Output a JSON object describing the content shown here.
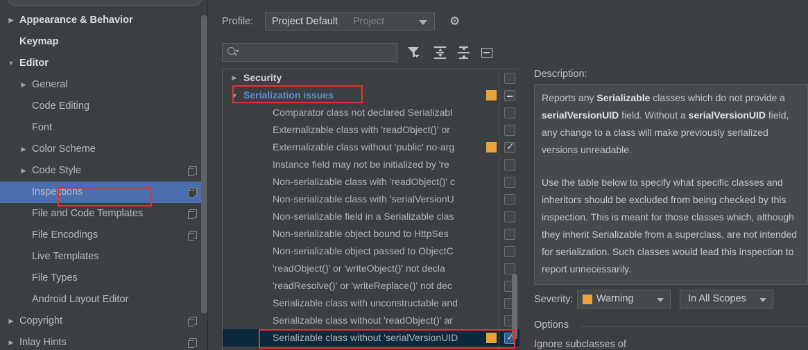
{
  "sidebar": {
    "search_placeholder": "",
    "items": [
      {
        "label": "Appearance & Behavior",
        "arrow": "collapsed",
        "indent": 28,
        "bold": true,
        "copy": false,
        "selected": false
      },
      {
        "label": "Keymap",
        "arrow": "none",
        "indent": 28,
        "bold": true,
        "copy": false,
        "selected": false
      },
      {
        "label": "Editor",
        "arrow": "expanded",
        "indent": 28,
        "bold": true,
        "copy": false,
        "selected": false
      },
      {
        "label": "General",
        "arrow": "collapsed",
        "indent": 46,
        "bold": false,
        "copy": false,
        "selected": false
      },
      {
        "label": "Code Editing",
        "arrow": "none",
        "indent": 46,
        "bold": false,
        "copy": false,
        "selected": false
      },
      {
        "label": "Font",
        "arrow": "none",
        "indent": 46,
        "bold": false,
        "copy": false,
        "selected": false
      },
      {
        "label": "Color Scheme",
        "arrow": "collapsed",
        "indent": 46,
        "bold": false,
        "copy": false,
        "selected": false
      },
      {
        "label": "Code Style",
        "arrow": "collapsed",
        "indent": 46,
        "bold": false,
        "copy": true,
        "selected": false
      },
      {
        "label": "Inspections",
        "arrow": "none",
        "indent": 46,
        "bold": false,
        "copy": true,
        "selected": true
      },
      {
        "label": "File and Code Templates",
        "arrow": "none",
        "indent": 46,
        "bold": false,
        "copy": true,
        "selected": false
      },
      {
        "label": "File Encodings",
        "arrow": "none",
        "indent": 46,
        "bold": false,
        "copy": true,
        "selected": false
      },
      {
        "label": "Live Templates",
        "arrow": "none",
        "indent": 46,
        "bold": false,
        "copy": false,
        "selected": false
      },
      {
        "label": "File Types",
        "arrow": "none",
        "indent": 46,
        "bold": false,
        "copy": false,
        "selected": false
      },
      {
        "label": "Android Layout Editor",
        "arrow": "none",
        "indent": 46,
        "bold": false,
        "copy": false,
        "selected": false
      },
      {
        "label": "Copyright",
        "arrow": "collapsed",
        "indent": 28,
        "bold": false,
        "copy": true,
        "selected": false
      },
      {
        "label": "Inlay Hints",
        "arrow": "collapsed",
        "indent": 28,
        "bold": false,
        "copy": true,
        "selected": false
      }
    ]
  },
  "toolbar": {
    "profile_label": "Profile:",
    "profile_value": "Project Default",
    "profile_scope": "Project",
    "gear_icon": "gear-icon",
    "search_value": "",
    "search_placeholder": "",
    "filter_icon": "filter-funnel-icon",
    "expand_all_icon": "expand-all-icon",
    "collapse_all_icon": "collapse-all-icon",
    "reset_icon": "box-minus-icon"
  },
  "tree": {
    "rows": [
      {
        "label": "Security",
        "arrow": "collapsed",
        "indent": 30,
        "group": true,
        "highlight": false,
        "severity": false,
        "checkbox": "unchecked",
        "selected": false
      },
      {
        "label": "Serialization issues",
        "arrow": "expanded",
        "indent": 30,
        "group": true,
        "highlight": true,
        "severity": true,
        "checkbox": "indeterminate",
        "selected": false
      },
      {
        "label": "Comparator class not declared Serializabl",
        "arrow": "none",
        "indent": 72,
        "group": false,
        "highlight": false,
        "severity": false,
        "checkbox": "unchecked",
        "selected": false
      },
      {
        "label": "Externalizable class with 'readObject()' or",
        "arrow": "none",
        "indent": 72,
        "group": false,
        "highlight": false,
        "severity": false,
        "checkbox": "unchecked",
        "selected": false
      },
      {
        "label": "Externalizable class without 'public' no-arg",
        "arrow": "none",
        "indent": 72,
        "group": false,
        "highlight": false,
        "severity": true,
        "checkbox": "checked",
        "selected": false
      },
      {
        "label": "Instance field may not be initialized by 're",
        "arrow": "none",
        "indent": 72,
        "group": false,
        "highlight": false,
        "severity": false,
        "checkbox": "unchecked",
        "selected": false
      },
      {
        "label": "Non-serializable class with 'readObject()' c",
        "arrow": "none",
        "indent": 72,
        "group": false,
        "highlight": false,
        "severity": false,
        "checkbox": "unchecked",
        "selected": false
      },
      {
        "label": "Non-serializable class with 'serialVersionU",
        "arrow": "none",
        "indent": 72,
        "group": false,
        "highlight": false,
        "severity": false,
        "checkbox": "unchecked",
        "selected": false
      },
      {
        "label": "Non-serializable field in a Serializable clas",
        "arrow": "none",
        "indent": 72,
        "group": false,
        "highlight": false,
        "severity": false,
        "checkbox": "unchecked",
        "selected": false
      },
      {
        "label": "Non-serializable object bound to HttpSes",
        "arrow": "none",
        "indent": 72,
        "group": false,
        "highlight": false,
        "severity": false,
        "checkbox": "unchecked",
        "selected": false
      },
      {
        "label": "Non-serializable object passed to ObjectC",
        "arrow": "none",
        "indent": 72,
        "group": false,
        "highlight": false,
        "severity": false,
        "checkbox": "unchecked",
        "selected": false
      },
      {
        "label": "'readObject()' or 'writeObject()' not decla",
        "arrow": "none",
        "indent": 72,
        "group": false,
        "highlight": false,
        "severity": false,
        "checkbox": "unchecked",
        "selected": false
      },
      {
        "label": "'readResolve()' or 'writeReplace()' not dec",
        "arrow": "none",
        "indent": 72,
        "group": false,
        "highlight": false,
        "severity": false,
        "checkbox": "unchecked",
        "selected": false
      },
      {
        "label": "Serializable class with unconstructable and",
        "arrow": "none",
        "indent": 72,
        "group": false,
        "highlight": false,
        "severity": false,
        "checkbox": "unchecked",
        "selected": false
      },
      {
        "label": "Serializable class without 'readObject()' ar",
        "arrow": "none",
        "indent": 72,
        "group": false,
        "highlight": false,
        "severity": false,
        "checkbox": "unchecked",
        "selected": false
      },
      {
        "label": "Serializable class without 'serialVersionUID",
        "arrow": "none",
        "indent": 72,
        "group": false,
        "highlight": false,
        "severity": true,
        "checkbox": "checked",
        "selected": true
      }
    ]
  },
  "description": {
    "label": "Description:",
    "paragraph1_parts": [
      {
        "text": "Reports any ",
        "bold": false
      },
      {
        "text": "Serializable",
        "bold": true
      },
      {
        "text": " classes which do not provide a ",
        "bold": false
      },
      {
        "text": "serialVersionUID",
        "bold": true
      },
      {
        "text": " field. Without a ",
        "bold": false
      },
      {
        "text": "serialVersionUID",
        "bold": true
      },
      {
        "text": " field, any change to a class will make previously serialized versions unreadable.",
        "bold": false
      }
    ],
    "paragraph2": "Use the table below to specify what specific classes and inheritors should be excluded from being checked by this inspection. This is meant for those classes which, although they inherit Serializable from a superclass, are not intended for serialization. Such classes would lead this inspection to report unnecessarily.",
    "severity_label": "Severity:",
    "severity_value": "Warning",
    "severity_color": "#e8a33d",
    "scope_value": "In All Scopes",
    "options_label": "Options",
    "options_first_field": "Ignore subclasses of"
  },
  "colors": {
    "background": "#3c3f41",
    "selection_blue": "#4b6eaf",
    "tree_selection": "#0d293e",
    "highlight_red": "#e83030",
    "warning_orange": "#e8a33d",
    "link_blue": "#5c8ede"
  }
}
